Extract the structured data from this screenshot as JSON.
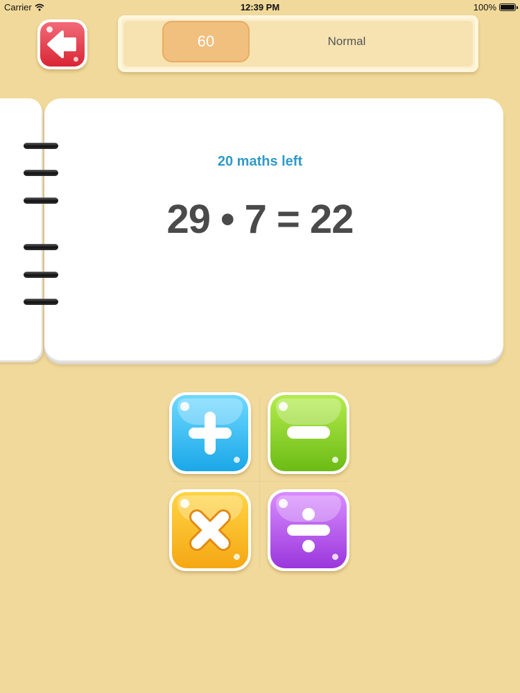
{
  "status_bar": {
    "carrier": "Carrier",
    "time": "12:39 PM",
    "battery": "100%"
  },
  "header": {
    "back_icon": "arrow-left-icon",
    "timer_value": "60",
    "mode": "Normal"
  },
  "question": {
    "remaining": "20 maths left",
    "equation": "29 • 7 = 22"
  },
  "operators": [
    {
      "name": "plus",
      "icon": "plus-icon",
      "color": "#27b6f0"
    },
    {
      "name": "minus",
      "icon": "minus-icon",
      "color": "#7dcc1e"
    },
    {
      "name": "times",
      "icon": "times-icon",
      "color": "#f6b21c"
    },
    {
      "name": "divide",
      "icon": "divide-icon",
      "color": "#a94de6"
    }
  ],
  "colors": {
    "background": "#f0d99a",
    "back_button": "#e03a48",
    "remaining_text": "#2f9ac8"
  }
}
